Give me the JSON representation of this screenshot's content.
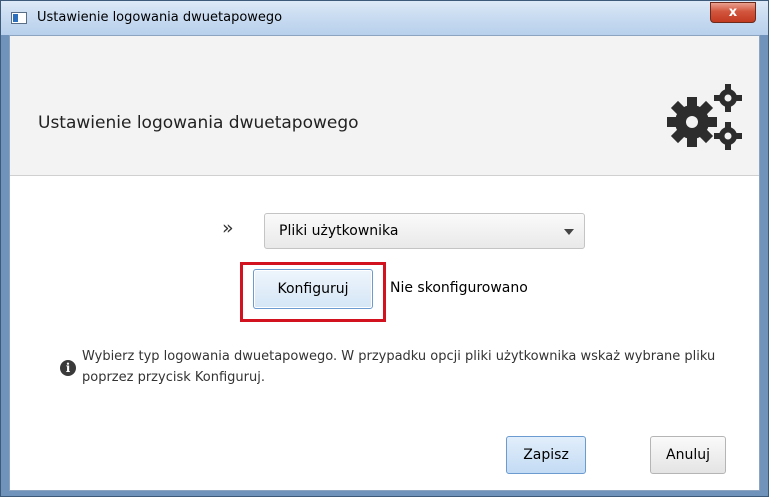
{
  "window": {
    "title": "Ustawienie logowania dwuetapowego",
    "close_glyph": "x",
    "icons": [
      "app-icon",
      "close-icon"
    ]
  },
  "header": {
    "title": "Ustawienie logowania dwuetapowego",
    "icon": "gears-icon"
  },
  "form": {
    "selector_glyph": "»",
    "type_select": {
      "value": "Pliki użytkownika"
    },
    "configure_label": "Konfiguruj",
    "status_text": "Nie skonfigurowano"
  },
  "info": {
    "icon": "info-icon",
    "glyph": "i",
    "text": "Wybierz typ  logowania dwuetapowego. W przypadku opcji  pliki użytkownika wskaż wybrane pliku poprzez przycisk Konfiguruj."
  },
  "footer": {
    "save_label": "Zapisz",
    "cancel_label": "Anuluj"
  },
  "colors": {
    "highlight_box": "#d3121f",
    "primary_button": "#c3dbf4",
    "title_bar": "#c9dcf1",
    "close_button": "#c23a21"
  }
}
